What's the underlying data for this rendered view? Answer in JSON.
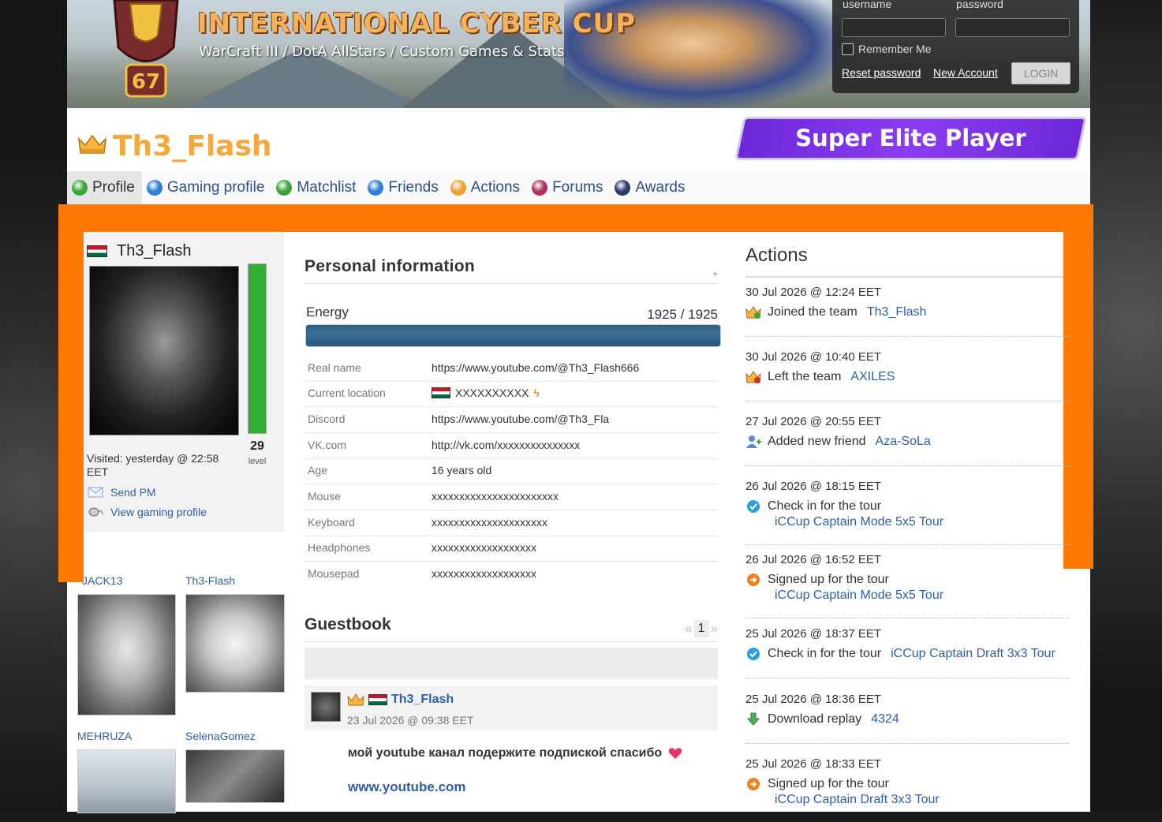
{
  "header": {
    "site_title": "INTERNATIONAL CYBER CUP",
    "site_subtitle": "WarCraft III / DotA AllStars / Custom Games & Stats",
    "badge_number": "67",
    "login": {
      "username_label": "username",
      "password_label": "password",
      "remember_label": "Remember Me",
      "reset_label": "Reset password",
      "new_account_label": "New Account",
      "login_button": "LOGIN"
    }
  },
  "player": {
    "name": "Th3_Flash",
    "rank_badge": "Super Elite Player"
  },
  "tabs": [
    {
      "label": "Profile",
      "icon": "profile-icon",
      "color": "#3aa63a"
    },
    {
      "label": "Gaming profile",
      "icon": "gaming-profile-icon",
      "color": "#2d7fd6"
    },
    {
      "label": "Matchlist",
      "icon": "matchlist-icon",
      "color": "#3aa63a"
    },
    {
      "label": "Friends",
      "icon": "friends-icon",
      "color": "#2d7fd6"
    },
    {
      "label": "Actions",
      "icon": "actions-icon",
      "color": "#f0a030"
    },
    {
      "label": "Forums",
      "icon": "forums-icon",
      "color": "#b03060"
    },
    {
      "label": "Awards",
      "icon": "awards-icon",
      "color": "#2a3a6a"
    }
  ],
  "colors": {
    "frame": "#ff7a05",
    "link": "#2f5fa8",
    "name": "#f6a83d",
    "elite": "#7b2ff0"
  },
  "card": {
    "name": "Th3_Flash",
    "level": "29",
    "level_label": "level",
    "level_fraction": 1.0,
    "visited": "Visited: yesterday @ 22:58 EET",
    "send_pm": "Send PM",
    "view_gaming": "View gaming profile"
  },
  "friends": [
    {
      "name": "JACK13"
    },
    {
      "name": "Th3-Flash"
    },
    {
      "name": "MEHRUZA"
    },
    {
      "name": "SelenaGomez"
    }
  ],
  "personal": {
    "title": "Personal information",
    "toggle": "+",
    "energy_label": "Energy",
    "energy_value": "1925 / 1925",
    "energy_fraction": 1.0,
    "rows": [
      {
        "key": "Real name",
        "value": "https://www.youtube.com/@Th3_Flash666"
      },
      {
        "key": "Current location",
        "value": "XXXXXXXXXX"
      },
      {
        "key": "Discord",
        "value": "https://www.youtube.com/@Th3_Fla"
      },
      {
        "key": "VK.com",
        "value": "http://vk.com/xxxxxxxxxxxxxxx"
      },
      {
        "key": "Age",
        "value": "16 years old"
      },
      {
        "key": "Mouse",
        "value": "xxxxxxxxxxxxxxxxxxxxxxx"
      },
      {
        "key": "Keyboard",
        "value": "xxxxxxxxxxxxxxxxxxxxx"
      },
      {
        "key": "Headphones",
        "value": "xxxxxxxxxxxxxxxxxxx"
      },
      {
        "key": "Mousepad",
        "value": "xxxxxxxxxxxxxxxxxxx"
      }
    ]
  },
  "guestbook": {
    "title": "Guestbook",
    "pager_prev": "«",
    "pager_page": "1",
    "pager_next": "»",
    "post": {
      "author": "Th3_Flash",
      "date": "23 Jul 2026 @ 09:38 EET",
      "message": "мой youtube канал подержите подпиской спасибо",
      "link": "www.youtube.com"
    }
  },
  "actions": {
    "title": "Actions",
    "items": [
      {
        "time": "30 Jul 2026 @ 12:24 EET",
        "text": "Joined the team",
        "link": "Th3_Flash",
        "icon": "team-join-icon"
      },
      {
        "time": "30 Jul 2026 @ 10:40 EET",
        "text": "Left the team",
        "link": "AXILES",
        "icon": "team-leave-icon"
      },
      {
        "time": "27 Jul 2026 @ 20:55 EET",
        "text": "Added new friend",
        "link": "Aza-SoLa",
        "icon": "add-friend-icon"
      },
      {
        "time": "26 Jul 2026 @ 18:15 EET",
        "text": "Check in for the tour",
        "sub": "iCCup Captain Mode 5x5 Tour",
        "icon": "check-in-icon"
      },
      {
        "time": "26 Jul 2026 @ 16:52 EET",
        "text": "Signed up for the tour",
        "sub": "iCCup Captain Mode 5x5 Tour",
        "icon": "sign-up-icon"
      },
      {
        "time": "25 Jul 2026 @ 18:37 EET",
        "text": "Check in for the tour",
        "link": "iCCup Captain Draft 3x3 Tour",
        "icon": "check-in-icon"
      },
      {
        "time": "25 Jul 2026 @ 18:36 EET",
        "text": "Download replay",
        "link": "4324",
        "icon": "download-icon"
      },
      {
        "time": "25 Jul 2026 @ 18:33 EET",
        "text": "Signed up for the tour",
        "sub": "iCCup Captain Draft 3x3 Tour",
        "icon": "sign-up-icon"
      }
    ]
  }
}
